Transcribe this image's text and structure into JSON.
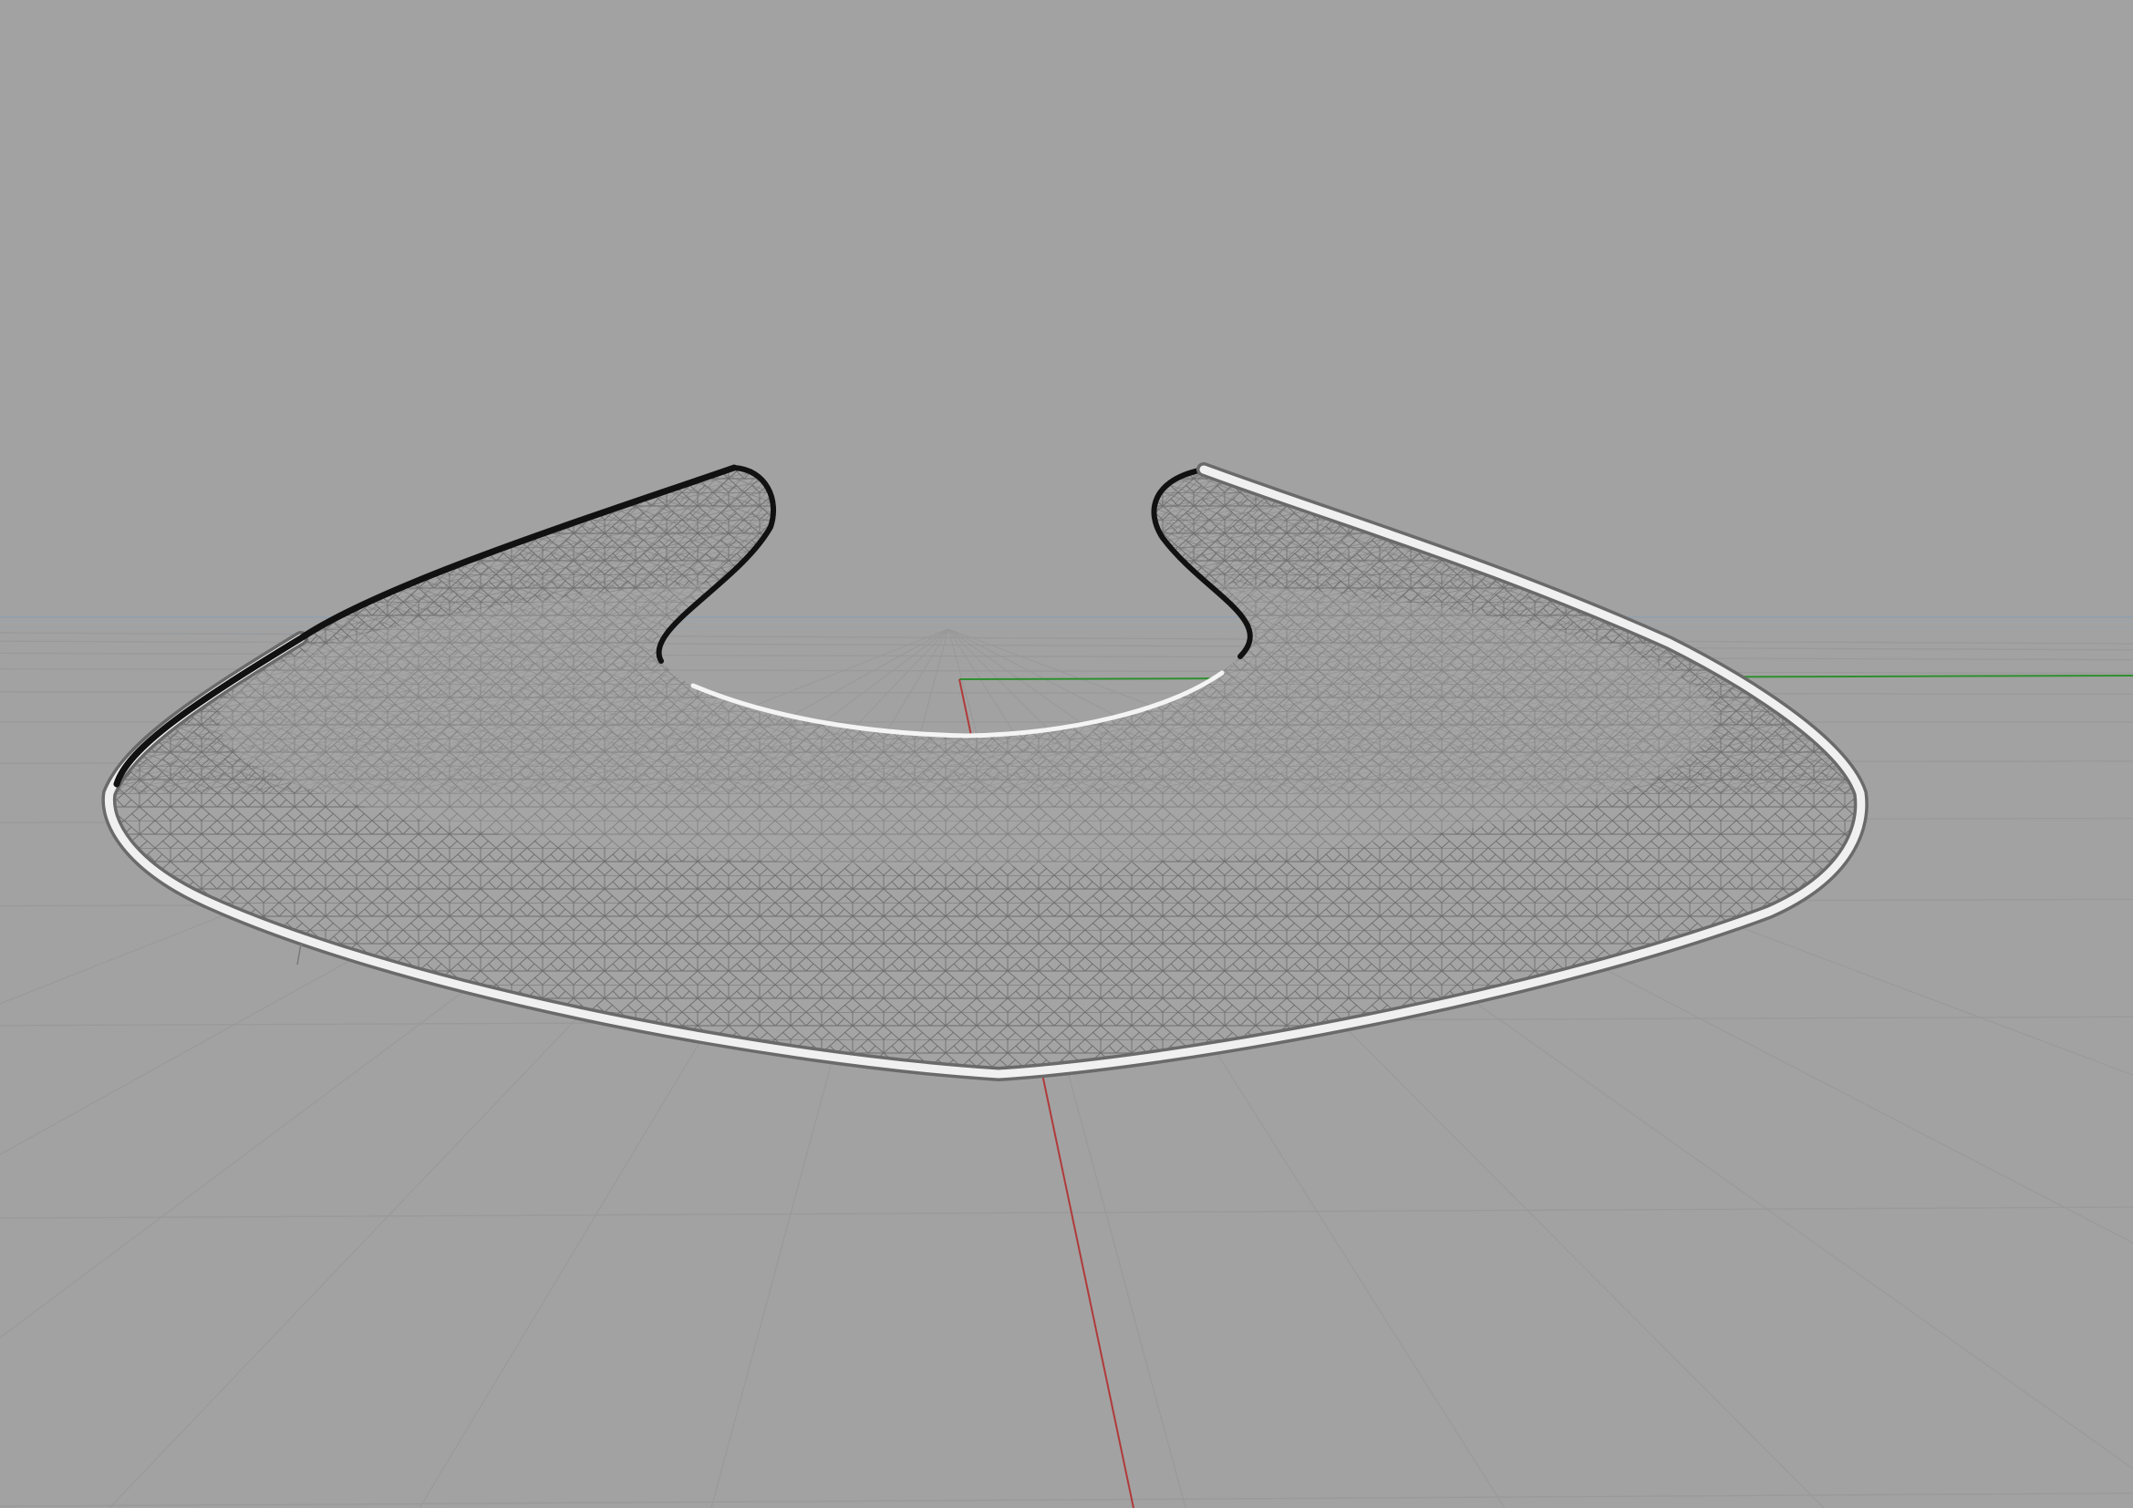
{
  "viewport": {
    "view": "perspective",
    "background_color": "#a2a2a2",
    "grid": {
      "visible": true,
      "line_color": "#999999",
      "horizon_tint": "#93a0ad"
    },
    "axes": {
      "x_axis_color": "#b03a3a",
      "y_axis_color": "#2f8f2f"
    },
    "object": {
      "shape": "horseshoe-shaped surface",
      "display": "wireframe-on-shaded",
      "surface_color": "#a4a4a4",
      "edge_color": "#f0f0f0",
      "inner_edge_color": "#111111"
    }
  }
}
